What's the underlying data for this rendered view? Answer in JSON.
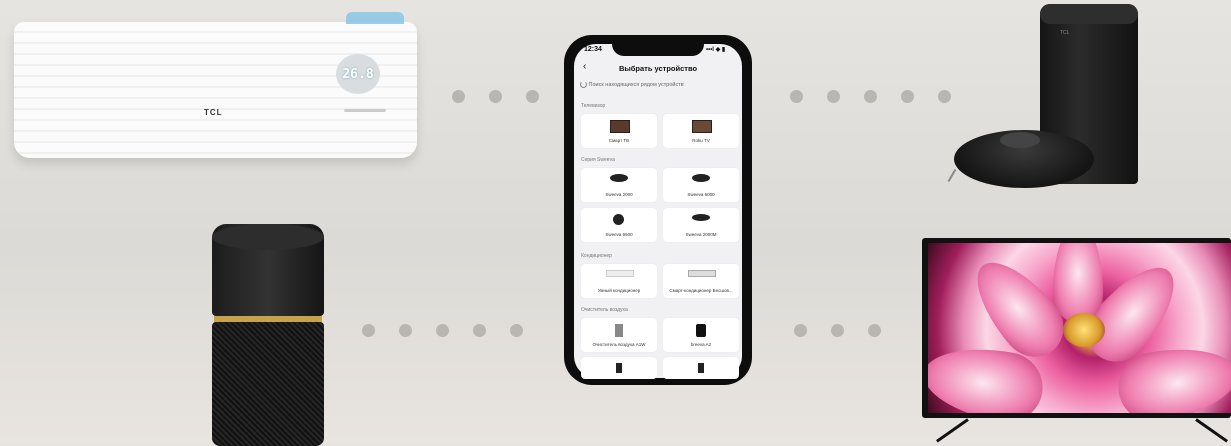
{
  "phone": {
    "status_time": "12:34",
    "status_icons": "•••l ◆ ▮",
    "back_glyph": "‹",
    "title": "Выбрать устройство",
    "search_text": "Поиск находящихся рядом устройств",
    "sections": [
      {
        "label": "Телевизор",
        "cards": [
          "Смарт ТВ",
          "Roku TV"
        ]
      },
      {
        "label": "Серия Sweeva",
        "cards": [
          "Sweeva 2000",
          "Sweeva 6000",
          "Sweeva 6500",
          "Sweeva 2000M"
        ]
      },
      {
        "label": "Кондиционер",
        "cards": [
          "Умный кондиционер",
          "Смарт-кондиционер Бесшов..."
        ]
      },
      {
        "label": "Очиститель воздуха",
        "cards": [
          "Очиститель воздуха A1W",
          "breeva A2"
        ]
      }
    ]
  },
  "ac": {
    "display": "26.8",
    "brand": "TCL"
  },
  "vacuum": {
    "brand": "TCL"
  },
  "colors": {
    "dot": "#b9b6b2",
    "purifier_ring": "#c8a24a",
    "ac_display": "#d9dde0"
  }
}
